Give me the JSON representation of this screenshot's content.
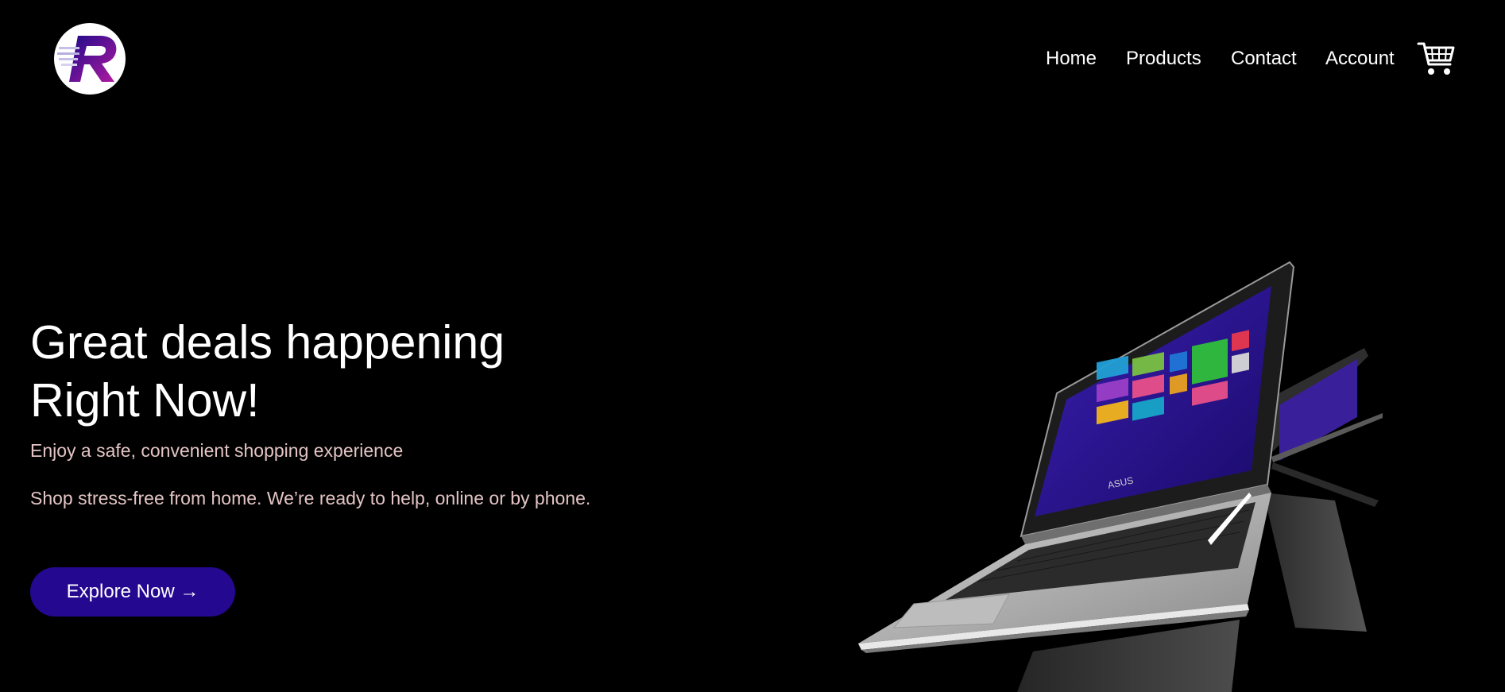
{
  "header": {
    "logo": {
      "letter": "R",
      "icon": "brand-logo-icon"
    },
    "nav": {
      "home": "Home",
      "products": "Products",
      "contact": "Contact",
      "account": "Account"
    },
    "cart_icon": "shopping-cart-icon"
  },
  "hero": {
    "title_line1": "Great deals happening",
    "title_line2": "Right Now!",
    "subtitle": "Enjoy a safe, convenient shopping experience",
    "description": "Shop stress-free from home. We’re ready to help, online or by phone.",
    "cta_label": "Explore Now →",
    "image": "convertible-laptop-image",
    "laptop_brand": "ASUS"
  },
  "colors": {
    "background": "#000000",
    "text": "#ffffff",
    "subtext": "#e3c4c4",
    "button": "#24088f",
    "logo_gradient_start": "#1d0a8a",
    "logo_gradient_end": "#b01aa0"
  }
}
